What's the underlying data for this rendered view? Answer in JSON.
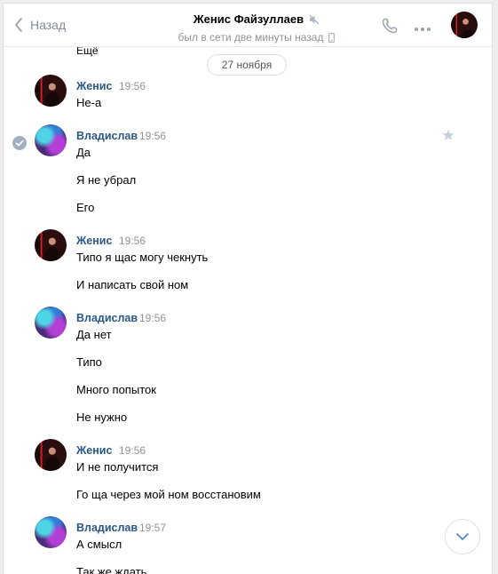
{
  "header": {
    "back_label": "Назад",
    "title": "Женис Файзуллаев",
    "status": "был в сети две минуты назад"
  },
  "feed": {
    "prev_text": "Ещё",
    "date_separator": "27 ноября",
    "groups": [
      {
        "author": "Женис",
        "time": "19:56",
        "messages": [
          "Не-а"
        ]
      },
      {
        "author": "Владислав",
        "time": "19:56",
        "messages": [
          "Да",
          "Я не убрал",
          "Его"
        ]
      },
      {
        "author": "Женис",
        "time": "19:56",
        "messages": [
          "Типо я щас могу чекнуть",
          "И написать свой ном"
        ]
      },
      {
        "author": "Владислав",
        "time": "19:56",
        "messages": [
          "Да нет",
          "Типо",
          "Много попыток",
          "Не нужно"
        ]
      },
      {
        "author": "Женис",
        "time": "19:56",
        "messages": [
          "И не получится",
          "Го ща через мой ном восстановим"
        ]
      },
      {
        "author": "Владислав",
        "time": "19:57",
        "messages": [
          "А смысл",
          "Так же ждать"
        ]
      }
    ]
  },
  "colors": {
    "author_name": "#2a5885",
    "accent": "#5181b8",
    "muted": "#939393"
  },
  "icons": [
    "back-chevron-icon",
    "muted-icon",
    "mobile-icon",
    "phone-icon",
    "more-icon",
    "checkmark-icon",
    "star-icon",
    "chevron-down-icon"
  ]
}
